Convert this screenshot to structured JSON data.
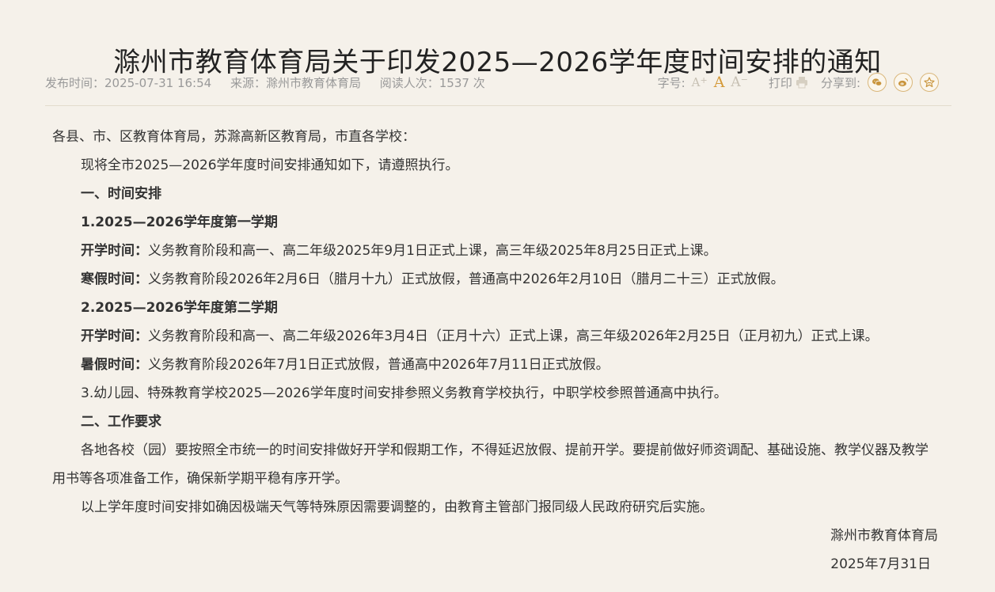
{
  "article": {
    "title": "滁州市教育体育局关于印发2025—2026学年度时间安排的通知",
    "meta": {
      "publish_time": "发布时间：2025-07-31 16:54",
      "source": "来源：滁州市教育体育局",
      "read_count": "阅读人次：1537 次"
    }
  },
  "toolbar": {
    "font_size_label": "字号:",
    "font_small": "A",
    "font_small_sign": "+",
    "font_medium": "A",
    "font_large": "A",
    "font_large_sign": "−",
    "print_label": "打印",
    "share_label": "分享到:"
  },
  "colors": {
    "accent": "#d49a3a",
    "muted": "#999999",
    "background": "#f5f1ea",
    "divider": "#e3dccd"
  },
  "icons": [
    "printer-icon",
    "wechat-icon",
    "weibo-icon",
    "favorite-star-icon"
  ],
  "body": {
    "greeting": "各县、市、区教育体育局，苏滁高新区教育局，市直各学校：",
    "intro": "现将全市2025—2026学年度时间安排通知如下，请遵照执行。",
    "section1_heading": "一、时间安排",
    "term1_heading": "1.2025—2026学年度第一学期",
    "term1_start_label": "开学时间：",
    "term1_start_text": "义务教育阶段和高一、高二年级2025年9月1日正式上课，高三年级2025年8月25日正式上课。",
    "winter_label": "寒假时间：",
    "winter_text": "义务教育阶段2026年2月6日（腊月十九）正式放假，普通高中2026年2月10日（腊月二十三）正式放假。",
    "term2_heading": "2.2025—2026学年度第二学期",
    "term2_start_label": "开学时间：",
    "term2_start_text": "义务教育阶段和高一、高二年级2026年3月4日（正月十六）正式上课，高三年级2026年2月25日（正月初九）正式上课。",
    "summer_label": "暑假时间：",
    "summer_text": "义务教育阶段2026年7月1日正式放假，普通高中2026年7月11日正式放假。",
    "item3": "3.幼儿园、特殊教育学校2025—2026学年度时间安排参照义务教育学校执行，中职学校参照普通高中执行。",
    "section2_heading": "二、工作要求",
    "requirement_paragraph": "各地各校（园）要按照全市统一的时间安排做好开学和假期工作，不得延迟放假、提前开学。要提前做好师资调配、基础设施、教学仪器及教学用书等各项准备工作，确保新学期平稳有序开学。",
    "adjust_paragraph": "以上学年度时间安排如确因极端天气等特殊原因需要调整的，由教育主管部门报同级人民政府研究后实施。",
    "signature_org": "滁州市教育体育局",
    "signature_date": "2025年7月31日"
  }
}
